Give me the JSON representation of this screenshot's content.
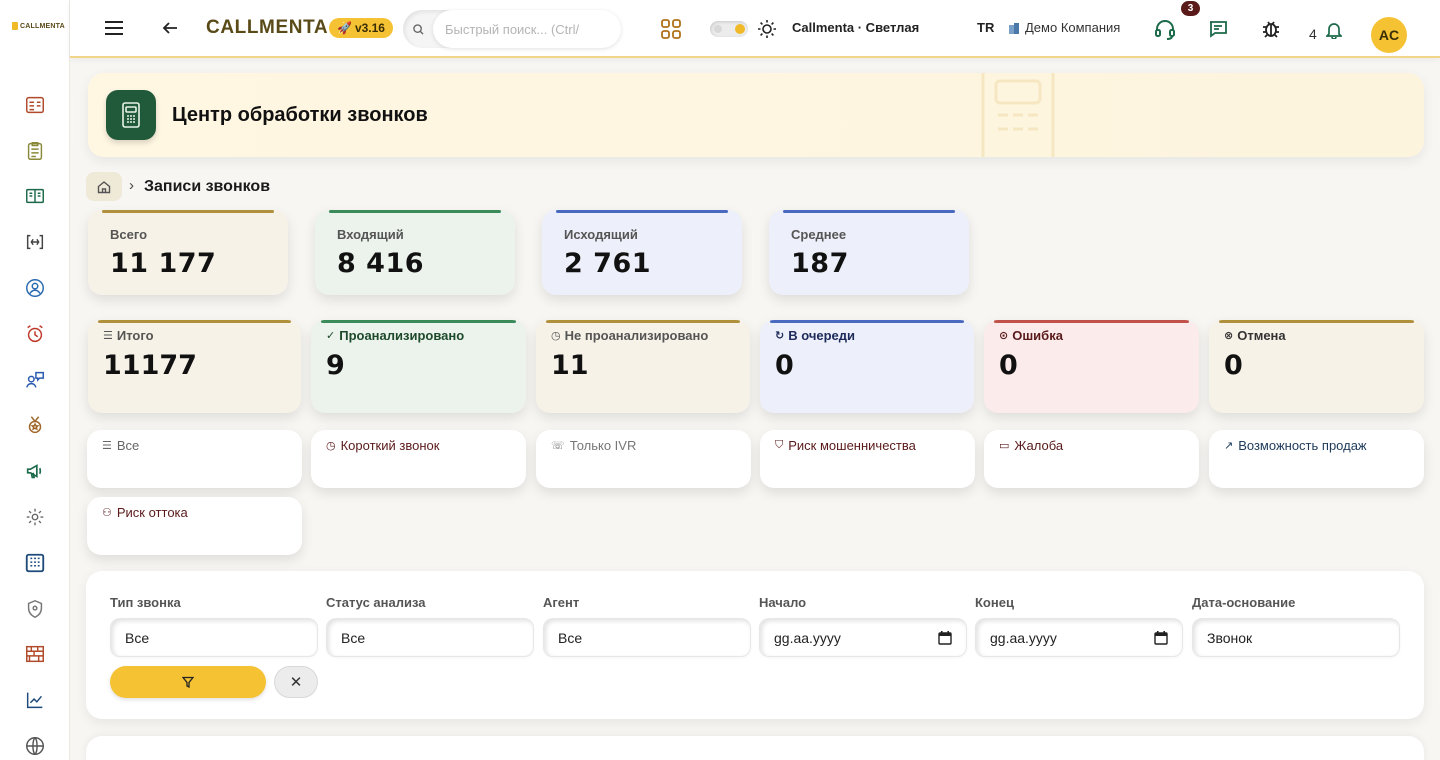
{
  "app": {
    "brand": "CALLMENTA",
    "sidebar_logo": "CALLMENTA",
    "version": "v3.16",
    "version_icon": "rocket-icon"
  },
  "topbar": {
    "search_placeholder": "Быстрый поиск... (Ctrl/",
    "theme_label": "Callmenta · Светлая",
    "language": "TR",
    "company": "Демо Компания",
    "support_badge": "3",
    "notification_count": "4",
    "avatar": "AC"
  },
  "hero": {
    "title": "Центр обработки звонков"
  },
  "breadcrumb": {
    "current": "Записи звонков",
    "separator": "›"
  },
  "summary": [
    {
      "label": "Всего",
      "value": "11 177"
    },
    {
      "label": "Входящий",
      "value": "8 416"
    },
    {
      "label": "Исходящий",
      "value": "2 761"
    },
    {
      "label": "Среднее",
      "value": "187"
    }
  ],
  "status": [
    {
      "icon": "☰",
      "label": "Итого",
      "value": "11177"
    },
    {
      "icon": "✓",
      "label": "Проанализировано",
      "value": "9"
    },
    {
      "icon": "◷",
      "label": "Не проанализировано",
      "value": "11"
    },
    {
      "icon": "↻",
      "label": "В очереди",
      "value": "0"
    },
    {
      "icon": "⊙",
      "label": "Ошибка",
      "value": "0"
    },
    {
      "icon": "⊗",
      "label": "Отмена",
      "value": "0"
    }
  ],
  "categories": [
    {
      "icon": "☰",
      "label": "Все"
    },
    {
      "icon": "◷",
      "label": "Короткий звонок"
    },
    {
      "icon": "☏",
      "label": "Только IVR"
    },
    {
      "icon": "⛉",
      "label": "Риск мошенничества"
    },
    {
      "icon": "▭",
      "label": "Жалоба"
    },
    {
      "icon": "↗",
      "label": "Возможность продаж"
    },
    {
      "icon": "⚇",
      "label": "Риск оттока"
    }
  ],
  "filters": {
    "fields": [
      {
        "label": "Тип звонка",
        "value": "Все",
        "kind": "select"
      },
      {
        "label": "Статус анализа",
        "value": "Все",
        "kind": "select"
      },
      {
        "label": "Агент",
        "value": "Все",
        "kind": "select"
      },
      {
        "label": "Начало",
        "value": "gg.aa.yyyy",
        "kind": "date"
      },
      {
        "label": "Конец",
        "value": "gg.aa.yyyy",
        "kind": "date"
      },
      {
        "label": "Дата-основание",
        "value": "Звонок",
        "kind": "select"
      }
    ],
    "clear_label": "✕"
  },
  "colors": {
    "accent": "#f5c233",
    "brand_text": "#5a4a18",
    "hero_icon_bg": "#215a3a"
  }
}
